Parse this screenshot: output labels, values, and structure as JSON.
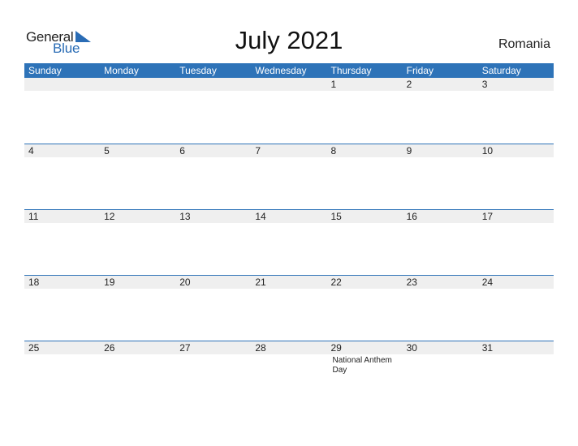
{
  "logo": {
    "line1": "General",
    "line2": "Blue"
  },
  "title": "July 2021",
  "country": "Romania",
  "colors": {
    "accent": "#2e73b8",
    "row_bg": "#efefef"
  },
  "weekdays": [
    "Sunday",
    "Monday",
    "Tuesday",
    "Wednesday",
    "Thursday",
    "Friday",
    "Saturday"
  ],
  "weeks": [
    {
      "days": [
        "",
        "",
        "",
        "",
        "1",
        "2",
        "3"
      ],
      "events": [
        "",
        "",
        "",
        "",
        "",
        "",
        ""
      ]
    },
    {
      "days": [
        "4",
        "5",
        "6",
        "7",
        "8",
        "9",
        "10"
      ],
      "events": [
        "",
        "",
        "",
        "",
        "",
        "",
        ""
      ]
    },
    {
      "days": [
        "11",
        "12",
        "13",
        "14",
        "15",
        "16",
        "17"
      ],
      "events": [
        "",
        "",
        "",
        "",
        "",
        "",
        ""
      ]
    },
    {
      "days": [
        "18",
        "19",
        "20",
        "21",
        "22",
        "23",
        "24"
      ],
      "events": [
        "",
        "",
        "",
        "",
        "",
        "",
        ""
      ]
    },
    {
      "days": [
        "25",
        "26",
        "27",
        "28",
        "29",
        "30",
        "31"
      ],
      "events": [
        "",
        "",
        "",
        "",
        "National Anthem Day",
        "",
        ""
      ]
    }
  ]
}
